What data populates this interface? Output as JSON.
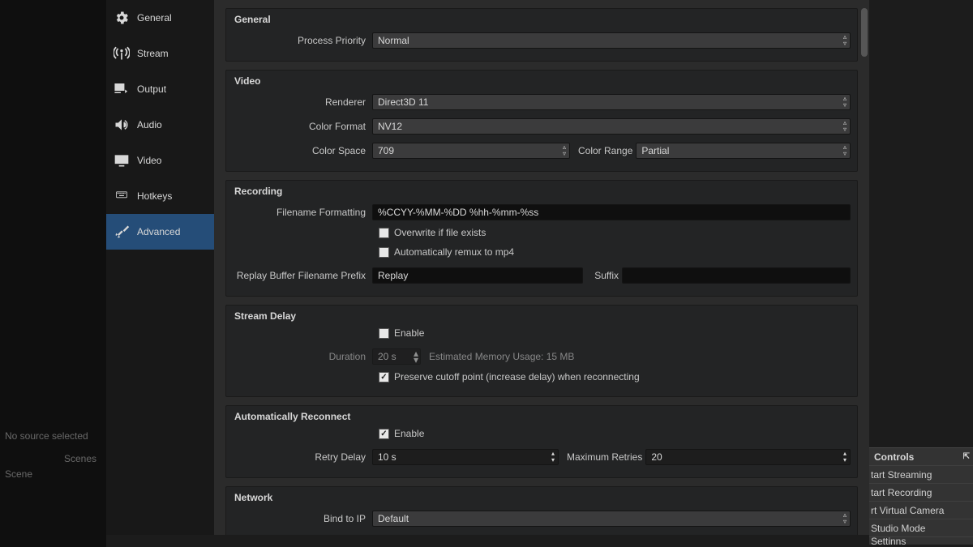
{
  "sidebar": {
    "items": [
      {
        "label": "General"
      },
      {
        "label": "Stream"
      },
      {
        "label": "Output"
      },
      {
        "label": "Audio"
      },
      {
        "label": "Video"
      },
      {
        "label": "Hotkeys"
      },
      {
        "label": "Advanced"
      }
    ]
  },
  "general": {
    "title": "General",
    "process_priority_label": "Process Priority",
    "process_priority_value": "Normal"
  },
  "video": {
    "title": "Video",
    "renderer_label": "Renderer",
    "renderer_value": "Direct3D 11",
    "color_format_label": "Color Format",
    "color_format_value": "NV12",
    "color_space_label": "Color Space",
    "color_space_value": "709",
    "color_range_label": "Color Range",
    "color_range_value": "Partial"
  },
  "recording": {
    "title": "Recording",
    "filename_label": "Filename Formatting",
    "filename_value": "%CCYY-%MM-%DD %hh-%mm-%ss",
    "overwrite": "Overwrite if file exists",
    "remux": "Automatically remux to mp4",
    "prefix_label": "Replay Buffer Filename Prefix",
    "prefix_value": "Replay",
    "suffix_label": "Suffix"
  },
  "stream_delay": {
    "title": "Stream Delay",
    "enable": "Enable",
    "duration_label": "Duration",
    "duration_value": "20 s",
    "memory": "Estimated Memory Usage: 15 MB",
    "preserve": "Preserve cutoff point (increase delay) when reconnecting"
  },
  "reconnect": {
    "title": "Automatically Reconnect",
    "enable": "Enable",
    "retry_label": "Retry Delay",
    "retry_value": "10 s",
    "maxretries_label": "Maximum Retries",
    "maxretries_value": "20"
  },
  "network": {
    "title": "Network",
    "bind_label": "Bind to IP",
    "bind_value": "Default"
  },
  "bg": {
    "no_source": "No source selected",
    "scenes": "Scenes",
    "scene": "Scene"
  },
  "controls": {
    "title": "Controls",
    "start_streaming": "tart Streaming",
    "start_recording": "tart Recording",
    "virtual_cam": "rt Virtual Camera",
    "studio": "Studio Mode",
    "settings": "Settinns"
  }
}
